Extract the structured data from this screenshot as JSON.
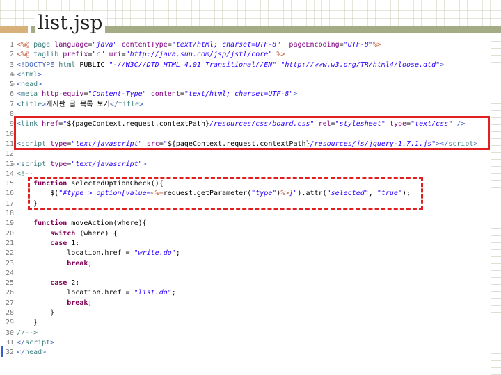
{
  "slide": {
    "title": "list.jsp"
  },
  "lines": [
    {
      "n": "1",
      "parts": [
        [
          "k-jsp",
          "<%@ "
        ],
        [
          "k-el",
          "page "
        ],
        [
          "k-attr",
          "language"
        ],
        [
          "k-plain",
          "="
        ],
        [
          "k-str",
          "\"java\""
        ],
        [
          "k-plain",
          " "
        ],
        [
          "k-attr",
          "contentType"
        ],
        [
          "k-plain",
          "="
        ],
        [
          "k-str",
          "\"text/html; charset=UTF-8\""
        ],
        [
          "k-plain",
          "  "
        ],
        [
          "k-attr",
          "pageEncoding"
        ],
        [
          "k-plain",
          "="
        ],
        [
          "k-str",
          "\"UTF-8\""
        ],
        [
          "k-jsp",
          "%>"
        ]
      ]
    },
    {
      "n": "2",
      "parts": [
        [
          "k-jsp",
          "<%@ "
        ],
        [
          "k-el",
          "taglib "
        ],
        [
          "k-attr",
          "prefix"
        ],
        [
          "k-plain",
          "="
        ],
        [
          "k-str",
          "\"c\""
        ],
        [
          "k-plain",
          " "
        ],
        [
          "k-attr",
          "uri"
        ],
        [
          "k-plain",
          "="
        ],
        [
          "k-str",
          "\"http://java.sun.com/jsp/jstl/core\""
        ],
        [
          "k-plain",
          " "
        ],
        [
          "k-jsp",
          "%>"
        ]
      ]
    },
    {
      "n": "3",
      "parts": [
        [
          "k-tag",
          "<!DOCTYPE "
        ],
        [
          "k-el",
          "html "
        ],
        [
          "k-plain",
          "PUBLIC "
        ],
        [
          "k-str",
          "\"-//W3C//DTD HTML 4.01 Transitional//EN\""
        ],
        [
          "k-plain",
          " "
        ],
        [
          "k-str",
          "\"http://www.w3.org/TR/html4/loose.dtd\""
        ],
        [
          "k-tag",
          ">"
        ]
      ]
    },
    {
      "n": "4",
      "fold": "⊖",
      "parts": [
        [
          "k-tag",
          "<"
        ],
        [
          "k-el",
          "html"
        ],
        [
          "k-tag",
          ">"
        ]
      ]
    },
    {
      "n": "5",
      "fold": "⊖",
      "parts": [
        [
          "k-tag",
          "<"
        ],
        [
          "k-el",
          "head"
        ],
        [
          "k-tag",
          ">"
        ]
      ]
    },
    {
      "n": "6",
      "parts": [
        [
          "k-tag",
          "<"
        ],
        [
          "k-el",
          "meta "
        ],
        [
          "k-attr",
          "http-equiv"
        ],
        [
          "k-plain",
          "="
        ],
        [
          "k-str",
          "\"Content-Type\""
        ],
        [
          "k-plain",
          " "
        ],
        [
          "k-attr",
          "content"
        ],
        [
          "k-plain",
          "="
        ],
        [
          "k-str",
          "\"text/html; charset=UTF-8\""
        ],
        [
          "k-tag",
          ">"
        ]
      ]
    },
    {
      "n": "7",
      "parts": [
        [
          "k-tag",
          "<"
        ],
        [
          "k-el",
          "title"
        ],
        [
          "k-tag",
          ">"
        ],
        [
          "k-plain",
          "게시판 글 목록 보기"
        ],
        [
          "k-tag",
          "</"
        ],
        [
          "k-el",
          "title"
        ],
        [
          "k-tag",
          ">"
        ]
      ]
    },
    {
      "n": "8",
      "parts": []
    },
    {
      "n": "9",
      "parts": [
        [
          "k-tag",
          "<"
        ],
        [
          "k-el",
          "link "
        ],
        [
          "k-attr",
          "href"
        ],
        [
          "k-plain",
          "="
        ],
        [
          "k-str",
          "\""
        ],
        [
          "k-plain",
          "${pageContext.request.contextPath}"
        ],
        [
          "k-str",
          "/resources/css/board.css\""
        ],
        [
          "k-plain",
          " "
        ],
        [
          "k-attr",
          "rel"
        ],
        [
          "k-plain",
          "="
        ],
        [
          "k-str",
          "\"stylesheet\""
        ],
        [
          "k-plain",
          " "
        ],
        [
          "k-attr",
          "type"
        ],
        [
          "k-plain",
          "="
        ],
        [
          "k-str",
          "\"text/css\""
        ],
        [
          "k-plain",
          " "
        ],
        [
          "k-tag",
          "/>"
        ]
      ]
    },
    {
      "n": "10",
      "parts": []
    },
    {
      "n": "11",
      "parts": [
        [
          "k-tag",
          "<"
        ],
        [
          "k-el",
          "script "
        ],
        [
          "k-attr",
          "type"
        ],
        [
          "k-plain",
          "="
        ],
        [
          "k-str",
          "\"text/javascript\""
        ],
        [
          "k-plain",
          " "
        ],
        [
          "k-attr",
          "src"
        ],
        [
          "k-plain",
          "="
        ],
        [
          "k-str",
          "\""
        ],
        [
          "k-plain",
          "${pageContext.request.contextPath}"
        ],
        [
          "k-str",
          "/resources/js/jquery-1.7.1.js\""
        ],
        [
          "k-tag",
          "></"
        ],
        [
          "k-el",
          "script"
        ],
        [
          "k-tag",
          ">"
        ]
      ]
    },
    {
      "n": "12",
      "parts": []
    },
    {
      "n": "13",
      "fold": "⊖",
      "parts": [
        [
          "k-tag",
          "<"
        ],
        [
          "k-el",
          "script "
        ],
        [
          "k-attr",
          "type"
        ],
        [
          "k-plain",
          "="
        ],
        [
          "k-str",
          "\"text/javascript\""
        ],
        [
          "k-tag",
          ">"
        ]
      ]
    },
    {
      "n": "14",
      "parts": [
        [
          "k-cm",
          "<!--"
        ]
      ]
    },
    {
      "n": "15",
      "parts": [
        [
          "k-plain",
          "    "
        ],
        [
          "k-kw",
          "function"
        ],
        [
          "k-plain",
          " selectedOptionCheck(){"
        ]
      ]
    },
    {
      "n": "16",
      "parts": [
        [
          "k-plain",
          "        $("
        ],
        [
          "k-str",
          "\"#type > option[value="
        ],
        [
          "k-jsp",
          "<%="
        ],
        [
          "k-plain",
          "request.getParameter("
        ],
        [
          "k-str",
          "\"type\""
        ],
        [
          "k-plain",
          ")"
        ],
        [
          "k-jsp",
          "%>"
        ],
        [
          "k-str",
          "]\""
        ],
        [
          "k-plain",
          ").attr("
        ],
        [
          "k-str",
          "\"selected\""
        ],
        [
          "k-plain",
          ", "
        ],
        [
          "k-str",
          "\"true\""
        ],
        [
          "k-plain",
          ");"
        ]
      ]
    },
    {
      "n": "17",
      "parts": [
        [
          "k-plain",
          "    }"
        ]
      ]
    },
    {
      "n": "18",
      "parts": []
    },
    {
      "n": "19",
      "parts": [
        [
          "k-plain",
          "    "
        ],
        [
          "k-kw",
          "function"
        ],
        [
          "k-plain",
          " moveAction(where){"
        ]
      ]
    },
    {
      "n": "20",
      "parts": [
        [
          "k-plain",
          "        "
        ],
        [
          "k-kw",
          "switch"
        ],
        [
          "k-plain",
          " (where) {"
        ]
      ]
    },
    {
      "n": "21",
      "parts": [
        [
          "k-plain",
          "        "
        ],
        [
          "k-kw",
          "case"
        ],
        [
          "k-plain",
          " 1:"
        ]
      ]
    },
    {
      "n": "22",
      "parts": [
        [
          "k-plain",
          "            location.href = "
        ],
        [
          "k-str",
          "\"write.do\""
        ],
        [
          "k-plain",
          ";"
        ]
      ]
    },
    {
      "n": "23",
      "parts": [
        [
          "k-plain",
          "            "
        ],
        [
          "k-kw",
          "break"
        ],
        [
          "k-plain",
          ";"
        ]
      ]
    },
    {
      "n": "24",
      "parts": []
    },
    {
      "n": "25",
      "parts": [
        [
          "k-plain",
          "        "
        ],
        [
          "k-kw",
          "case"
        ],
        [
          "k-plain",
          " 2:"
        ]
      ]
    },
    {
      "n": "26",
      "parts": [
        [
          "k-plain",
          "            location.href = "
        ],
        [
          "k-str",
          "\"list.do\""
        ],
        [
          "k-plain",
          ";"
        ]
      ]
    },
    {
      "n": "27",
      "parts": [
        [
          "k-plain",
          "            "
        ],
        [
          "k-kw",
          "break"
        ],
        [
          "k-plain",
          ";"
        ]
      ]
    },
    {
      "n": "28",
      "parts": [
        [
          "k-plain",
          "        }"
        ]
      ]
    },
    {
      "n": "29",
      "parts": [
        [
          "k-plain",
          "    }"
        ]
      ]
    },
    {
      "n": "30",
      "parts": [
        [
          "k-cm",
          "//-->"
        ]
      ]
    },
    {
      "n": "31",
      "parts": [
        [
          "k-tag",
          "</"
        ],
        [
          "k-el",
          "script"
        ],
        [
          "k-tag",
          ">"
        ]
      ]
    },
    {
      "n": "32",
      "parts": [
        [
          "k-tag",
          "</"
        ],
        [
          "k-el",
          "head"
        ],
        [
          "k-tag",
          ">"
        ]
      ]
    }
  ]
}
